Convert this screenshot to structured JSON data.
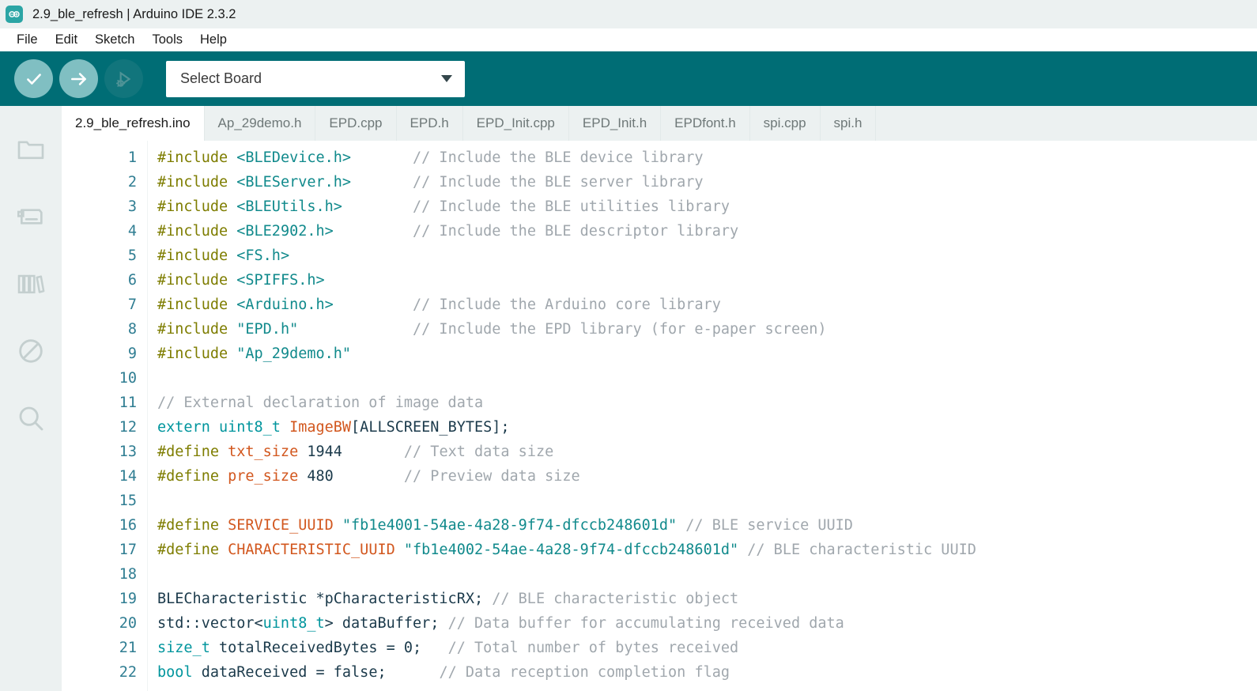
{
  "window": {
    "title": "2.9_ble_refresh | Arduino IDE 2.3.2",
    "logo_icon": "arduino-infinity-icon"
  },
  "menubar": {
    "items": [
      {
        "label": "File"
      },
      {
        "label": "Edit"
      },
      {
        "label": "Sketch"
      },
      {
        "label": "Tools"
      },
      {
        "label": "Help"
      }
    ]
  },
  "toolbar": {
    "verify_label": "Verify",
    "verify_icon": "checkmark-icon",
    "upload_label": "Upload",
    "upload_icon": "arrow-right-icon",
    "debug_label": "Debug",
    "debug_icon": "debug-bug-icon",
    "board_select": {
      "value": "Select Board",
      "caret_icon": "chevron-down-icon"
    },
    "background_color": "#006D75"
  },
  "sidebar": {
    "items": [
      {
        "name": "sketchbook",
        "icon": "folder-icon"
      },
      {
        "name": "boards-manager",
        "icon": "boards-manager-icon"
      },
      {
        "name": "library-manager",
        "icon": "books-icon"
      },
      {
        "name": "debug",
        "icon": "no-entry-icon"
      },
      {
        "name": "search",
        "icon": "magnifier-icon"
      }
    ]
  },
  "tabs": [
    {
      "label": "2.9_ble_refresh.ino",
      "active": true
    },
    {
      "label": "Ap_29demo.h",
      "active": false
    },
    {
      "label": "EPD.cpp",
      "active": false
    },
    {
      "label": "EPD.h",
      "active": false
    },
    {
      "label": "EPD_Init.cpp",
      "active": false
    },
    {
      "label": "EPD_Init.h",
      "active": false
    },
    {
      "label": "EPDfont.h",
      "active": false
    },
    {
      "label": "spi.cpp",
      "active": false
    },
    {
      "label": "spi.h",
      "active": false
    }
  ],
  "editor": {
    "lines": [
      {
        "n": "1",
        "tokens": [
          {
            "t": "#include ",
            "c": "t-pre"
          },
          {
            "t": "<BLEDevice.h>",
            "c": "t-hdr"
          },
          {
            "t": "       ",
            "c": "t-plain"
          },
          {
            "t": "// Include the BLE device library",
            "c": "t-com"
          }
        ]
      },
      {
        "n": "2",
        "tokens": [
          {
            "t": "#include ",
            "c": "t-pre"
          },
          {
            "t": "<BLEServer.h>",
            "c": "t-hdr"
          },
          {
            "t": "       ",
            "c": "t-plain"
          },
          {
            "t": "// Include the BLE server library",
            "c": "t-com"
          }
        ]
      },
      {
        "n": "3",
        "tokens": [
          {
            "t": "#include ",
            "c": "t-pre"
          },
          {
            "t": "<BLEUtils.h>",
            "c": "t-hdr"
          },
          {
            "t": "        ",
            "c": "t-plain"
          },
          {
            "t": "// Include the BLE utilities library",
            "c": "t-com"
          }
        ]
      },
      {
        "n": "4",
        "tokens": [
          {
            "t": "#include ",
            "c": "t-pre"
          },
          {
            "t": "<BLE2902.h>",
            "c": "t-hdr"
          },
          {
            "t": "         ",
            "c": "t-plain"
          },
          {
            "t": "// Include the BLE descriptor library",
            "c": "t-com"
          }
        ]
      },
      {
        "n": "5",
        "tokens": [
          {
            "t": "#include ",
            "c": "t-pre"
          },
          {
            "t": "<FS.h>",
            "c": "t-hdr"
          }
        ]
      },
      {
        "n": "6",
        "tokens": [
          {
            "t": "#include ",
            "c": "t-pre"
          },
          {
            "t": "<SPIFFS.h>",
            "c": "t-hdr"
          }
        ]
      },
      {
        "n": "7",
        "tokens": [
          {
            "t": "#include ",
            "c": "t-pre"
          },
          {
            "t": "<Arduino.h>",
            "c": "t-hdr"
          },
          {
            "t": "         ",
            "c": "t-plain"
          },
          {
            "t": "// Include the Arduino core library",
            "c": "t-com"
          }
        ]
      },
      {
        "n": "8",
        "tokens": [
          {
            "t": "#include ",
            "c": "t-pre"
          },
          {
            "t": "\"EPD.h\"",
            "c": "t-str"
          },
          {
            "t": "             ",
            "c": "t-plain"
          },
          {
            "t": "// Include the EPD library (for e-paper screen)",
            "c": "t-com"
          }
        ]
      },
      {
        "n": "9",
        "tokens": [
          {
            "t": "#include ",
            "c": "t-pre"
          },
          {
            "t": "\"Ap_29demo.h\"",
            "c": "t-str"
          }
        ]
      },
      {
        "n": "10",
        "tokens": [
          {
            "t": "",
            "c": "t-plain"
          }
        ]
      },
      {
        "n": "11",
        "tokens": [
          {
            "t": "// External declaration of image data",
            "c": "t-com"
          }
        ]
      },
      {
        "n": "12",
        "tokens": [
          {
            "t": "extern ",
            "c": "t-kw"
          },
          {
            "t": "uint8_t ",
            "c": "t-kw"
          },
          {
            "t": "ImageBW",
            "c": "t-id"
          },
          {
            "t": "[ALLSCREEN_BYTES];",
            "c": "t-plain"
          }
        ]
      },
      {
        "n": "13",
        "tokens": [
          {
            "t": "#define ",
            "c": "t-pre"
          },
          {
            "t": "txt_size ",
            "c": "t-id"
          },
          {
            "t": "1944",
            "c": "t-num"
          },
          {
            "t": "       ",
            "c": "t-plain"
          },
          {
            "t": "// Text data size",
            "c": "t-com"
          }
        ]
      },
      {
        "n": "14",
        "tokens": [
          {
            "t": "#define ",
            "c": "t-pre"
          },
          {
            "t": "pre_size ",
            "c": "t-id"
          },
          {
            "t": "480",
            "c": "t-num"
          },
          {
            "t": "        ",
            "c": "t-plain"
          },
          {
            "t": "// Preview data size",
            "c": "t-com"
          }
        ]
      },
      {
        "n": "15",
        "tokens": [
          {
            "t": "",
            "c": "t-plain"
          }
        ]
      },
      {
        "n": "16",
        "tokens": [
          {
            "t": "#define ",
            "c": "t-pre"
          },
          {
            "t": "SERVICE_UUID ",
            "c": "t-id"
          },
          {
            "t": "\"fb1e4001-54ae-4a28-9f74-dfccb248601d\"",
            "c": "t-str"
          },
          {
            "t": " ",
            "c": "t-plain"
          },
          {
            "t": "// BLE service UUID",
            "c": "t-com"
          }
        ]
      },
      {
        "n": "17",
        "tokens": [
          {
            "t": "#define ",
            "c": "t-pre"
          },
          {
            "t": "CHARACTERISTIC_UUID ",
            "c": "t-id"
          },
          {
            "t": "\"fb1e4002-54ae-4a28-9f74-dfccb248601d\"",
            "c": "t-str"
          },
          {
            "t": " ",
            "c": "t-plain"
          },
          {
            "t": "// BLE characteristic UUID",
            "c": "t-com"
          }
        ]
      },
      {
        "n": "18",
        "tokens": [
          {
            "t": "",
            "c": "t-plain"
          }
        ]
      },
      {
        "n": "19",
        "tokens": [
          {
            "t": "BLECharacteristic *pCharacteristicRX; ",
            "c": "t-plain"
          },
          {
            "t": "// BLE characteristic object",
            "c": "t-com"
          }
        ]
      },
      {
        "n": "20",
        "tokens": [
          {
            "t": "std::vector<",
            "c": "t-plain"
          },
          {
            "t": "uint8_t",
            "c": "t-kw"
          },
          {
            "t": "> dataBuffer; ",
            "c": "t-plain"
          },
          {
            "t": "// Data buffer for accumulating received data",
            "c": "t-com"
          }
        ]
      },
      {
        "n": "21",
        "tokens": [
          {
            "t": "size_t ",
            "c": "t-kw"
          },
          {
            "t": "totalReceivedBytes = 0;",
            "c": "t-plain"
          },
          {
            "t": "   ",
            "c": "t-plain"
          },
          {
            "t": "// Total number of bytes received",
            "c": "t-com"
          }
        ]
      },
      {
        "n": "22",
        "tokens": [
          {
            "t": "bool ",
            "c": "t-kw"
          },
          {
            "t": "dataReceived = false;",
            "c": "t-plain"
          },
          {
            "t": "      ",
            "c": "t-plain"
          },
          {
            "t": "// Data reception completion flag",
            "c": "t-com"
          }
        ]
      }
    ]
  }
}
